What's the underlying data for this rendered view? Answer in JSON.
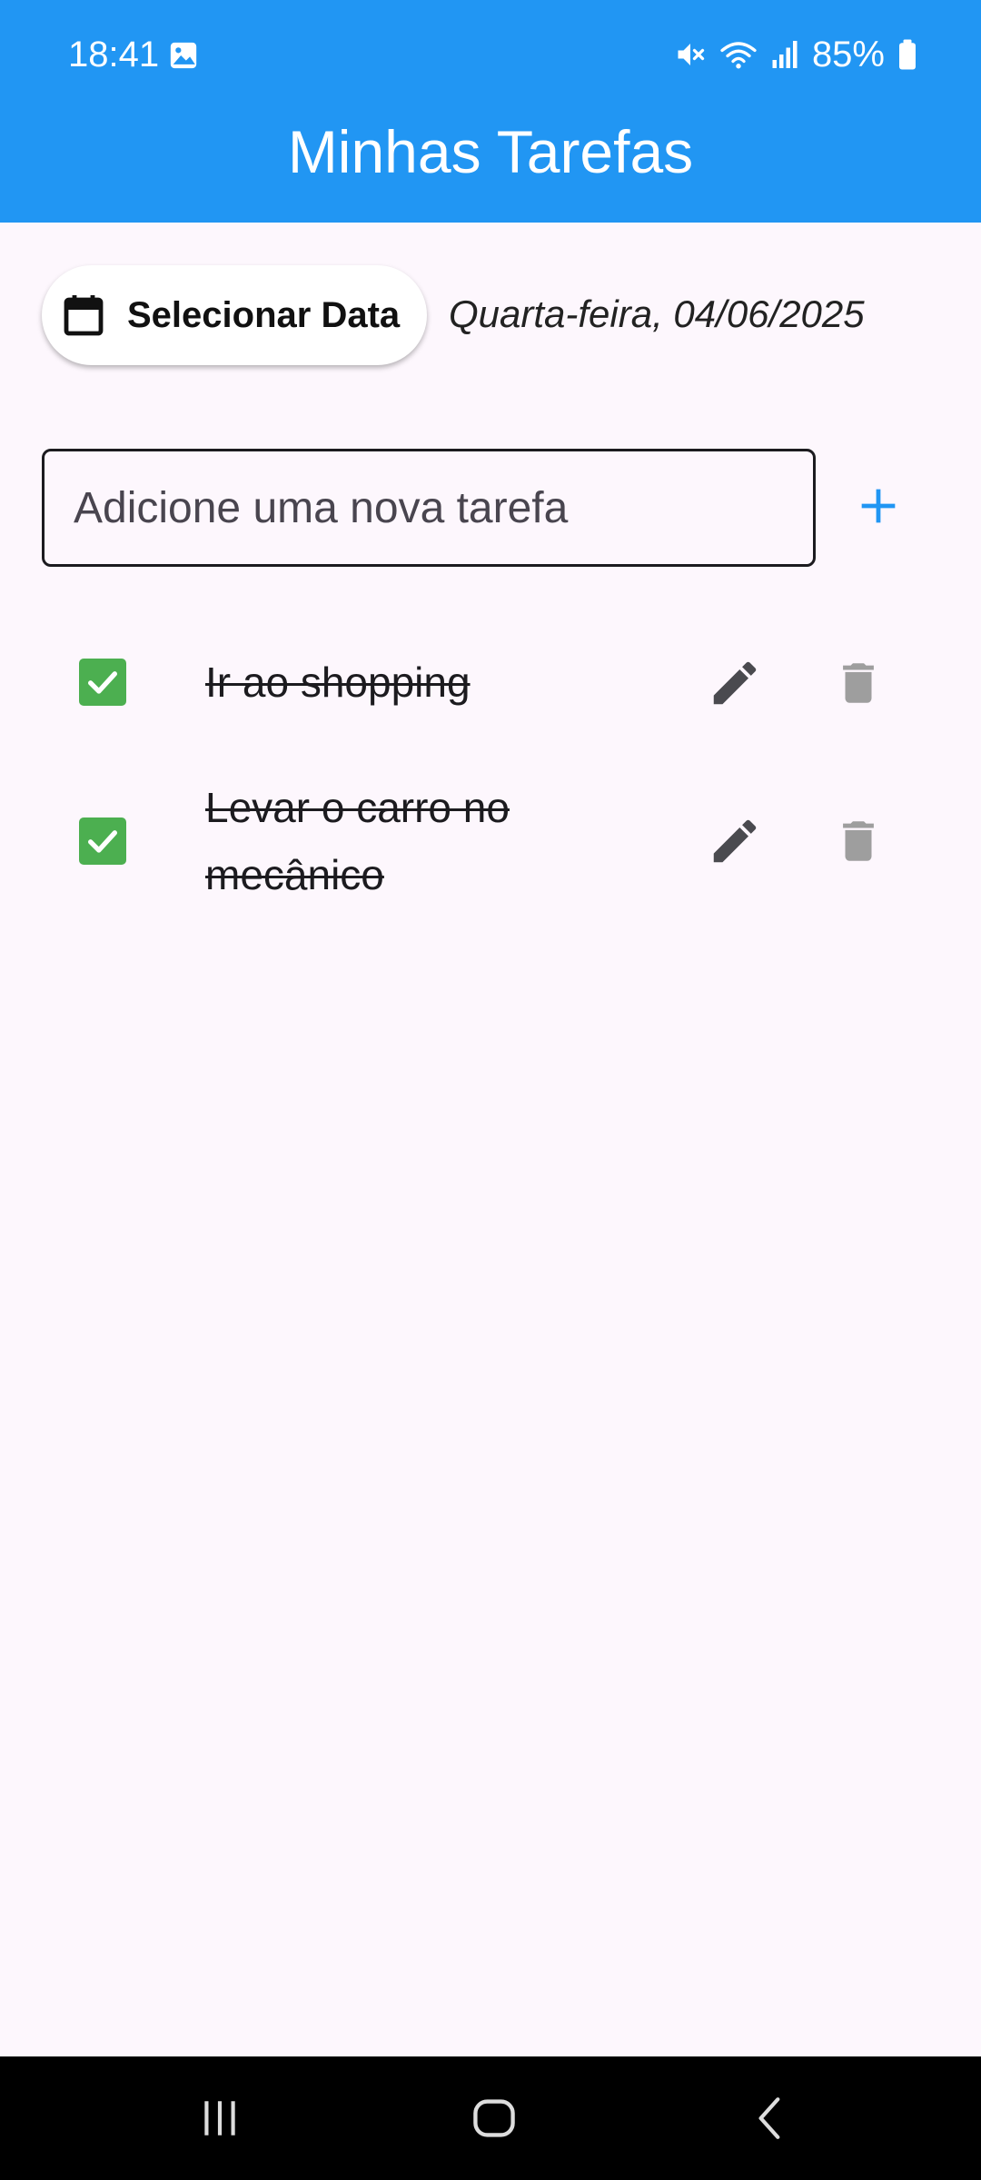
{
  "status_bar": {
    "time": "18:41",
    "battery": "85%",
    "icons": [
      "photo-icon",
      "mute-icon",
      "wifi-icon",
      "signal-icon",
      "battery-icon"
    ]
  },
  "app_bar": {
    "title": "Minhas Tarefas",
    "color": "#2196f3"
  },
  "date_picker": {
    "button_label": "Selecionar Data",
    "icon": "calendar-icon",
    "selected_date": "Quarta-feira, 04/06/2025"
  },
  "new_task": {
    "placeholder": "Adicione uma nova tarefa",
    "value": "",
    "add_icon": "plus-icon"
  },
  "tasks": [
    {
      "title": "Ir ao shopping",
      "done": true
    },
    {
      "title": "Levar o carro no mecânico",
      "done": true
    }
  ],
  "colors": {
    "accent": "#2196f3",
    "check": "#4caf50",
    "edit_icon": "#4a4a4f",
    "delete_icon": "#9e9e9e",
    "background": "#fdf7fd"
  },
  "navigation": [
    "recent-apps-icon",
    "home-icon",
    "back-icon"
  ]
}
